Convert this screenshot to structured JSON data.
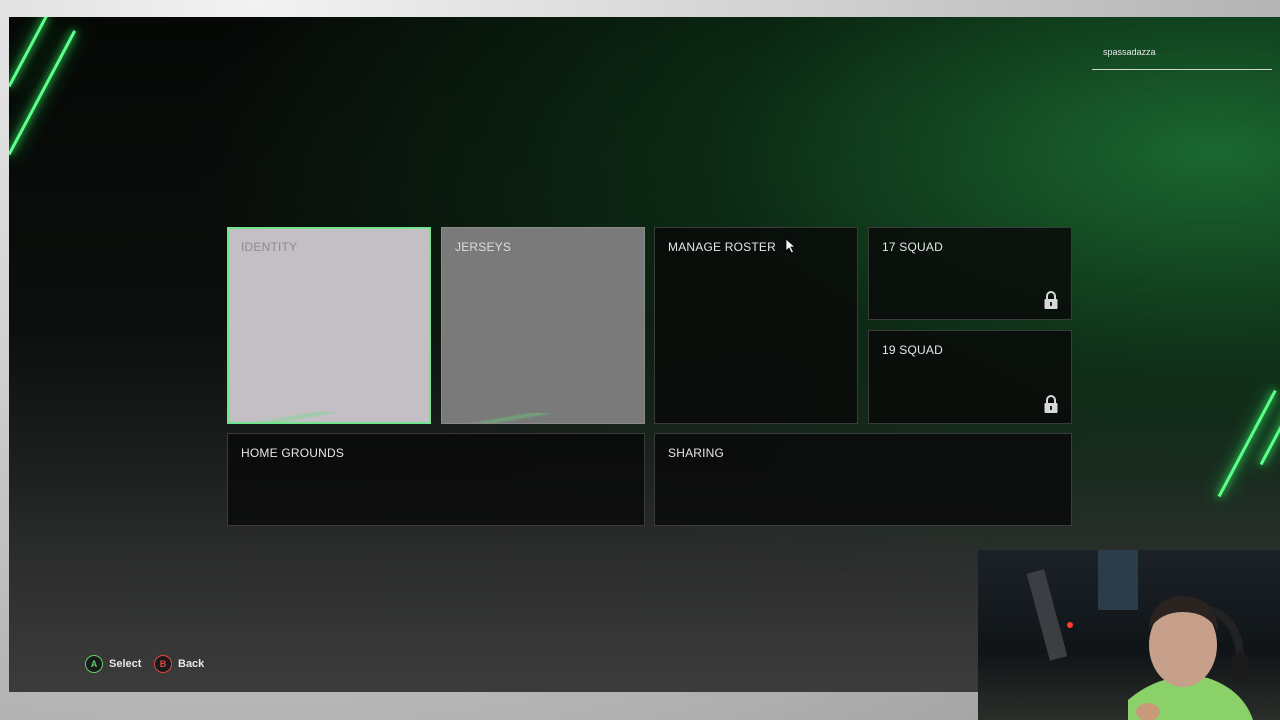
{
  "user": {
    "name": "spassadazza"
  },
  "tiles": {
    "identity": {
      "label": "IDENTITY"
    },
    "jerseys": {
      "label": "JERSEYS"
    },
    "manage_roster": {
      "label": "MANAGE ROSTER"
    },
    "squad17": {
      "label": "17 SQUAD",
      "icon": "lock-icon"
    },
    "squad19": {
      "label": "19 SQUAD",
      "icon": "lock-icon"
    },
    "home_grounds": {
      "label": "HOME GROUNDS"
    },
    "sharing": {
      "label": "SHARING"
    }
  },
  "controls": {
    "select": {
      "key": "A",
      "label": "Select",
      "color": "#5bd36a"
    },
    "back": {
      "key": "B",
      "label": "Back",
      "color": "#e04545"
    }
  },
  "colors": {
    "accent": "#5dff8d",
    "selected_border": "#74e38d"
  }
}
